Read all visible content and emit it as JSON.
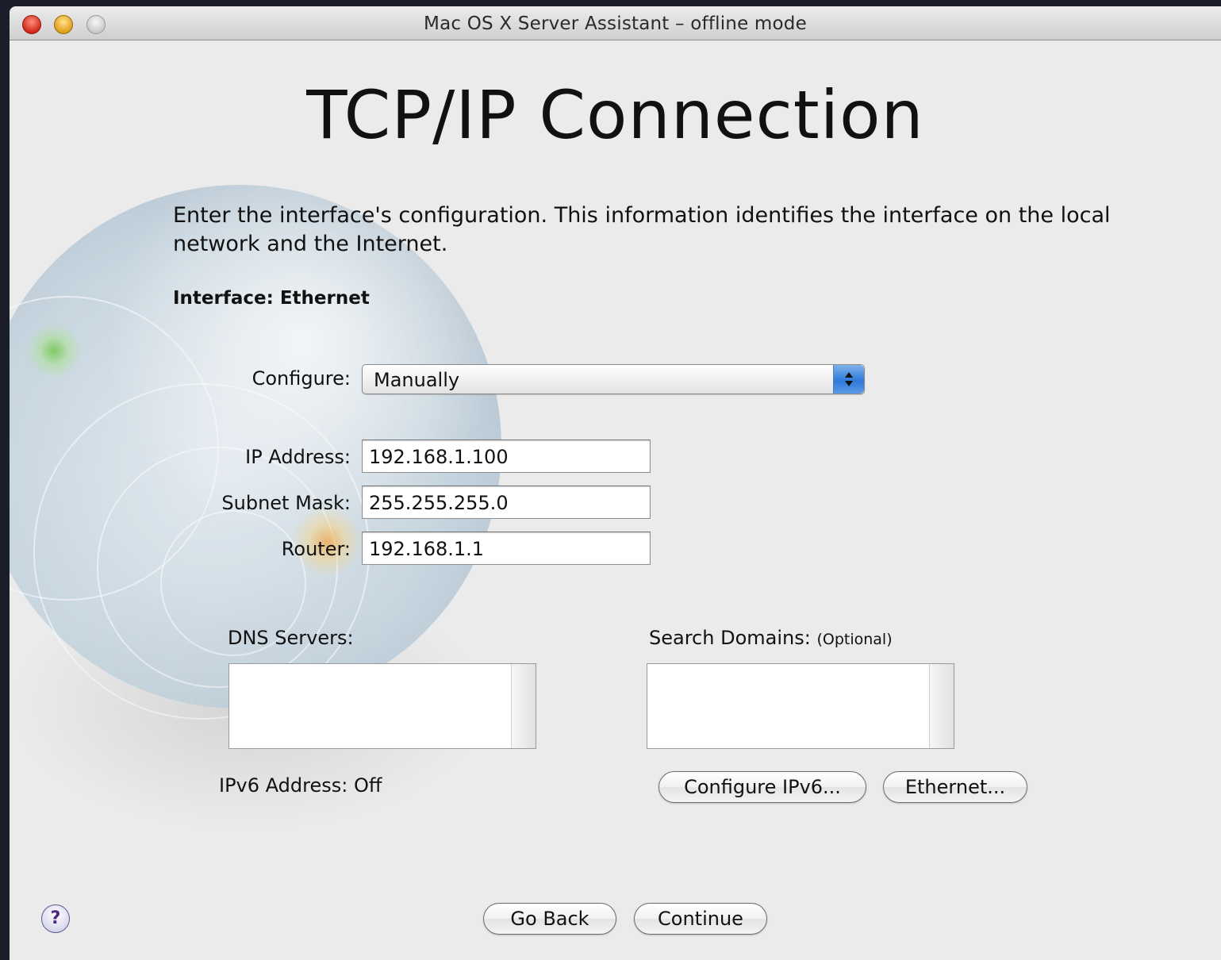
{
  "window": {
    "title": "Mac OS X Server Assistant – offline mode"
  },
  "page": {
    "heading": "TCP/IP Connection",
    "description": "Enter the interface's configuration.  This information identifies the interface on the local network and the Internet.",
    "interface_label": "Interface: Ethernet"
  },
  "form": {
    "configure_label": "Configure:",
    "configure_value": "Manually",
    "ip_label": "IP Address:",
    "ip_value": "192.168.1.100",
    "subnet_label": "Subnet Mask:",
    "subnet_value": "255.255.255.0",
    "router_label": "Router:",
    "router_value": "192.168.1.1",
    "dns_label": "DNS Servers:",
    "search_label": "Search Domains:",
    "search_optional": "(Optional)",
    "ipv6_label": "IPv6 Address:",
    "ipv6_value": "Off"
  },
  "buttons": {
    "configure_ipv6": "Configure IPv6...",
    "ethernet": "Ethernet...",
    "go_back": "Go Back",
    "continue": "Continue",
    "help": "?"
  },
  "icons": {
    "close": "close-light-icon",
    "minimize": "minimize-light-icon",
    "zoom": "zoom-light-icon",
    "help": "help-icon",
    "popup": "popup-arrows-icon",
    "globe": "globe-icon"
  },
  "colors": {
    "accent_blue": "#2f79d8",
    "close_red": "#d2281b",
    "minimize_yellow": "#e0a01a",
    "help_purple": "#4b2a7b"
  }
}
